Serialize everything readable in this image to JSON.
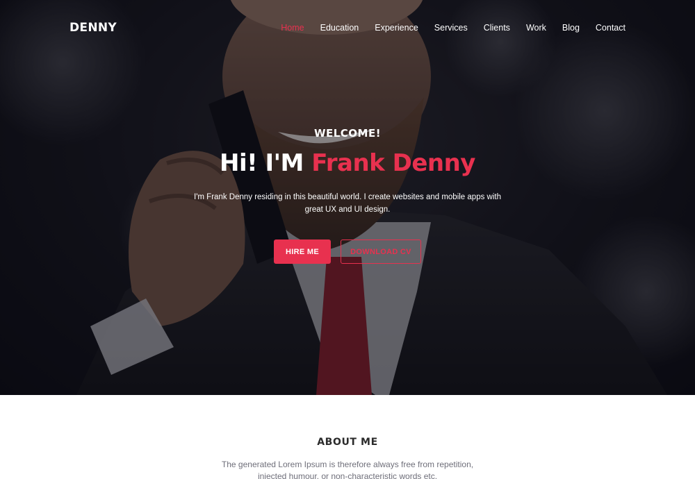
{
  "brand": {
    "name": "DENNY"
  },
  "nav": {
    "items": [
      {
        "label": "Home",
        "active": true
      },
      {
        "label": "Education"
      },
      {
        "label": "Experience"
      },
      {
        "label": "Services"
      },
      {
        "label": "Clients"
      },
      {
        "label": "Work"
      },
      {
        "label": "Blog"
      },
      {
        "label": "Contact"
      }
    ]
  },
  "hero": {
    "welcome": "WELCOME!",
    "headline_prefix": "Hi! I'M ",
    "headline_name": "Frank Denny",
    "intro": "I'm Frank Denny residing in this beautiful world. I create websites and mobile apps with great UX and UI design.",
    "hire_label": "HIRE ME",
    "cv_label": "DOWNLOAD CV"
  },
  "about": {
    "title": "ABOUT ME",
    "text": "The generated Lorem Ipsum is therefore always free from repetition, injected humour, or non-characteristic words etc."
  },
  "colors": {
    "accent": "#e8314f",
    "hero_dark": "#0c0c12",
    "text_muted": "#6f6f7a"
  }
}
